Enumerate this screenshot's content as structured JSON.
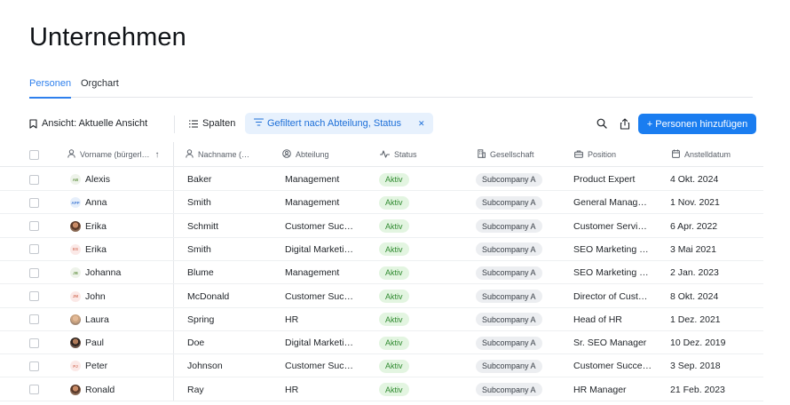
{
  "page": {
    "title": "Unternehmen"
  },
  "tabs": [
    {
      "label": "Personen",
      "active": true
    },
    {
      "label": "Orgchart",
      "active": false
    }
  ],
  "toolbar": {
    "view_label": "Ansicht: Aktuelle Ansicht",
    "columns_label": "Spalten",
    "filter_label": "Gefiltert nach Abteilung, Status",
    "filter_clear": "✕",
    "add_label": "+ Personen hinzufügen"
  },
  "colors": {
    "accent": "#1a7df0",
    "status_bg": "#e3f5e1",
    "status_text": "#2f8a2f",
    "tab_active": "#2f80ed"
  },
  "table": {
    "columns": [
      {
        "key": "vorname",
        "label": "Vorname (bürgerl…",
        "icon": "person-icon",
        "sorted": "asc"
      },
      {
        "key": "nachname",
        "label": "Nachname (…",
        "icon": "person-icon"
      },
      {
        "key": "abteilung",
        "label": "Abteilung",
        "icon": "circle-person-icon"
      },
      {
        "key": "status",
        "label": "Status",
        "icon": "activity-icon"
      },
      {
        "key": "gesellschaft",
        "label": "Gesellschaft",
        "icon": "building-icon"
      },
      {
        "key": "position",
        "label": "Position",
        "icon": "briefcase-icon"
      },
      {
        "key": "anstelldatum",
        "label": "Anstelldatum",
        "icon": "calendar-icon"
      }
    ],
    "sort_indicator": "↑",
    "rows": [
      {
        "avatar": "AB",
        "avatar_type": "initials",
        "vorname": "Alexis",
        "nachname": "Baker",
        "abteilung": "Management",
        "status": "Aktiv",
        "gesellschaft": "Subcompany A",
        "position": "Product Expert",
        "anstelldatum": "4 Okt. 2024"
      },
      {
        "avatar": "APP",
        "avatar_type": "initials-blue",
        "vorname": "Anna",
        "nachname": "Smith",
        "abteilung": "Management",
        "status": "Aktiv",
        "gesellschaft": "Subcompany A",
        "position": "General Manag…",
        "anstelldatum": "1 Nov. 2021"
      },
      {
        "avatar": "",
        "avatar_type": "photo",
        "vorname": "Erika",
        "nachname": "Schmitt",
        "abteilung": "Customer Suc…",
        "status": "Aktiv",
        "gesellschaft": "Subcompany A",
        "position": "Customer Servi…",
        "anstelldatum": "6 Apr. 2022"
      },
      {
        "avatar": "ES",
        "avatar_type": "initials-red",
        "vorname": "Erika",
        "nachname": "Smith",
        "abteilung": "Digital Marketi…",
        "status": "Aktiv",
        "gesellschaft": "Subcompany A",
        "position": "SEO Marketing …",
        "anstelldatum": "3 Mai 2021"
      },
      {
        "avatar": "JB",
        "avatar_type": "initials",
        "vorname": "Johanna",
        "nachname": "Blume",
        "abteilung": "Management",
        "status": "Aktiv",
        "gesellschaft": "Subcompany A",
        "position": "SEO Marketing …",
        "anstelldatum": "2 Jan. 2023"
      },
      {
        "avatar": "JM",
        "avatar_type": "initials-red",
        "vorname": "John",
        "nachname": "McDonald",
        "abteilung": "Customer Suc…",
        "status": "Aktiv",
        "gesellschaft": "Subcompany A",
        "position": "Director of Cust…",
        "anstelldatum": "8 Okt. 2024"
      },
      {
        "avatar": "",
        "avatar_type": "photo-light",
        "vorname": "Laura",
        "nachname": "Spring",
        "abteilung": "HR",
        "status": "Aktiv",
        "gesellschaft": "Subcompany A",
        "position": "Head of HR",
        "anstelldatum": "1 Dez. 2021"
      },
      {
        "avatar": "",
        "avatar_type": "photo-dark",
        "vorname": "Paul",
        "nachname": "Doe",
        "abteilung": "Digital Marketi…",
        "status": "Aktiv",
        "gesellschaft": "Subcompany A",
        "position": "Sr. SEO Manager",
        "anstelldatum": "10 Dez. 2019"
      },
      {
        "avatar": "PJ",
        "avatar_type": "initials-red",
        "vorname": "Peter",
        "nachname": "Johnson",
        "abteilung": "Customer Suc…",
        "status": "Aktiv",
        "gesellschaft": "Subcompany A",
        "position": "Customer Succe…",
        "anstelldatum": "3 Sep. 2018"
      },
      {
        "avatar": "",
        "avatar_type": "photo",
        "vorname": "Ronald",
        "nachname": "Ray",
        "abteilung": "HR",
        "status": "Aktiv",
        "gesellschaft": "Subcompany A",
        "position": "HR Manager",
        "anstelldatum": "21 Feb. 2023"
      }
    ]
  }
}
